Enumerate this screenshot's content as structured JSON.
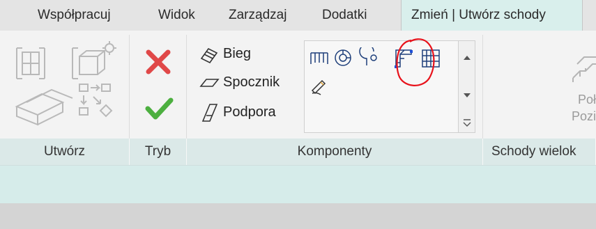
{
  "tabs": [
    {
      "label": "Współpracuj"
    },
    {
      "label": "Widok"
    },
    {
      "label": "Zarządzaj"
    },
    {
      "label": "Dodatki"
    },
    {
      "label": "Zmień | Utwórz schody"
    }
  ],
  "panels": {
    "create": {
      "label": "Utwórz"
    },
    "mode": {
      "label": "Tryb"
    },
    "components": {
      "label": "Komponenty",
      "commands": [
        "Bieg",
        "Spocznik",
        "Podpora"
      ]
    },
    "multistory": {
      "label": "Schody wielok",
      "button_line1": "Poł",
      "button_line2": "Pozi"
    }
  },
  "colors": {
    "accent": "#d9efec",
    "cancel": "#e04848",
    "finish": "#4caf3f",
    "annotation": "#e8121b"
  }
}
